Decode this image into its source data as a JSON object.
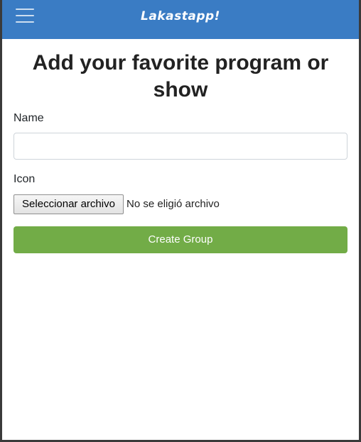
{
  "navbar": {
    "menu_icon": "hamburger-menu-icon",
    "brand": "Lakastapp!",
    "background_color": "#3a7cc4"
  },
  "page": {
    "title": "Add your favorite program or show"
  },
  "form": {
    "name_label": "Name",
    "name_value": "",
    "icon_label": "Icon",
    "file_button_label": "Seleccionar archivo",
    "file_status": "No se eligió archivo",
    "submit_label": "Create Group",
    "submit_color": "#72ac47"
  }
}
